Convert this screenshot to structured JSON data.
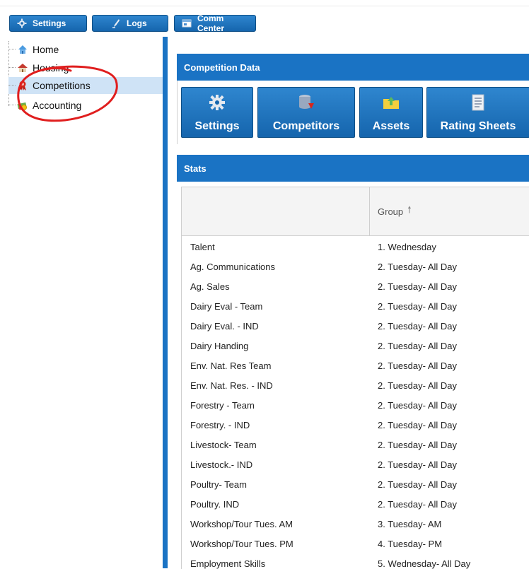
{
  "toolbar": {
    "settings_label": "Settings",
    "logs_label": "Logs",
    "comm_label": "Comm Center"
  },
  "tree": {
    "items": [
      {
        "label": "Home"
      },
      {
        "label": "Housing"
      },
      {
        "label": "Competitions"
      },
      {
        "label": "Accounting"
      }
    ]
  },
  "competition_panel": {
    "title": "Competition Data",
    "buttons": [
      {
        "label": "Settings",
        "icon": "gear-icon"
      },
      {
        "label": "Competitors",
        "icon": "database-icon"
      },
      {
        "label": "Assets",
        "icon": "folder-upload-icon"
      },
      {
        "label": "Rating Sheets",
        "icon": "document-icon"
      }
    ]
  },
  "stats_panel": {
    "title": "Stats",
    "column_group": "Group",
    "rows": [
      {
        "name": "Talent",
        "group": "1. Wednesday"
      },
      {
        "name": "Ag. Communications",
        "group": "2. Tuesday- All Day"
      },
      {
        "name": "Ag. Sales",
        "group": "2. Tuesday- All Day"
      },
      {
        "name": "Dairy Eval - Team",
        "group": "2. Tuesday- All Day"
      },
      {
        "name": "Dairy Eval. - IND",
        "group": "2. Tuesday- All Day"
      },
      {
        "name": "Dairy Handing",
        "group": "2. Tuesday- All Day"
      },
      {
        "name": "Env. Nat. Res Team",
        "group": "2. Tuesday- All Day"
      },
      {
        "name": "Env. Nat. Res. - IND",
        "group": "2. Tuesday- All Day"
      },
      {
        "name": "Forestry - Team",
        "group": "2. Tuesday- All Day"
      },
      {
        "name": "Forestry. - IND",
        "group": "2. Tuesday- All Day"
      },
      {
        "name": "Livestock- Team",
        "group": "2. Tuesday- All Day"
      },
      {
        "name": "Livestock.- IND",
        "group": "2. Tuesday- All Day"
      },
      {
        "name": "Poultry- Team",
        "group": "2. Tuesday- All Day"
      },
      {
        "name": "Poultry. IND",
        "group": "2. Tuesday- All Day"
      },
      {
        "name": "Workshop/Tour Tues. AM",
        "group": "3. Tuesday- AM"
      },
      {
        "name": "Workshop/Tour Tues. PM",
        "group": "4. Tuesday- PM"
      },
      {
        "name": "Employment Skills",
        "group": "5. Wednesday- All Day"
      }
    ]
  },
  "colors": {
    "accent": "#1a73c4",
    "selected_row": "#cfe3f6",
    "annotation": "#e01e1e"
  }
}
